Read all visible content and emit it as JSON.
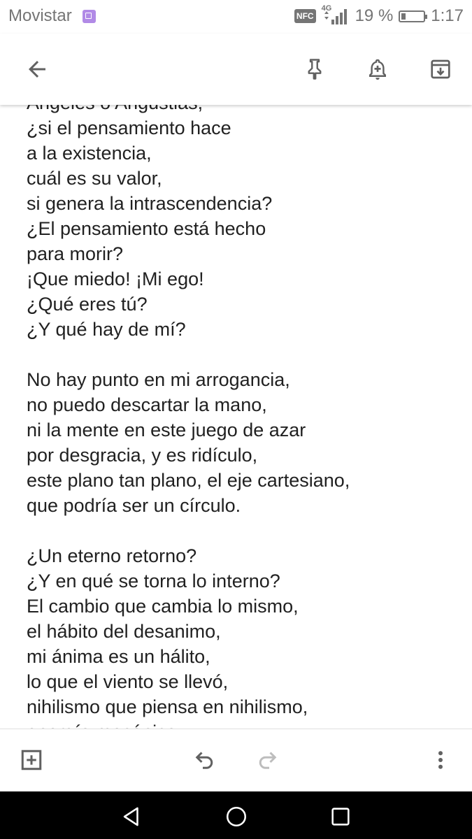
{
  "status_bar": {
    "carrier": "Movistar",
    "nfc_label": "NFC",
    "network_type": "4G",
    "battery_percent": "19 %",
    "battery_level": 0.19,
    "time": "1:17"
  },
  "toolbar": {
    "icons": [
      "back-arrow-icon",
      "pin-icon",
      "reminder-bell-icon",
      "archive-icon"
    ]
  },
  "note": {
    "lines": [
      "Ángeles o Angustias,",
      "¿si el pensamiento hace",
      "a la existencia,",
      "cuál es su valor,",
      "si genera la intrascendencia?",
      "¿El pensamiento está hecho",
      "para morir?",
      "¡Que miedo! ¡Mi ego!",
      "¿Qué eres tú?",
      "¿Y qué hay de mí?",
      "",
      "No hay punto en mi arrogancia,",
      "no puedo descartar la mano,",
      "ni la mente en este juego de azar",
      "por desgracia, y es ridículo,",
      "este plano tan plano, el eje cartesiano,",
      "que podría ser un círculo.",
      "",
      "¿Un eterno retorno?",
      "¿Y en qué se torna lo interno?",
      "El cambio que cambia lo mismo,",
      "el hábito del desanimo,",
      "mi ánima es un hálito,",
      "lo que el viento se llevó,",
      "nihilismo que piensa en nihilismo,",
      "energía mecánica"
    ]
  },
  "bottom_bar": {
    "icons": [
      "add-box-icon",
      "undo-icon",
      "redo-icon",
      "more-vert-icon"
    ],
    "redo_enabled": false
  },
  "nav_bar": {
    "icons": [
      "nav-back-icon",
      "nav-home-icon",
      "nav-recents-icon"
    ]
  },
  "colors": {
    "text": "#212121",
    "icon": "#757575",
    "carrier_badge": "#b18ae6",
    "nav_background": "#000000",
    "redo_disabled": "#bdbdbd"
  }
}
